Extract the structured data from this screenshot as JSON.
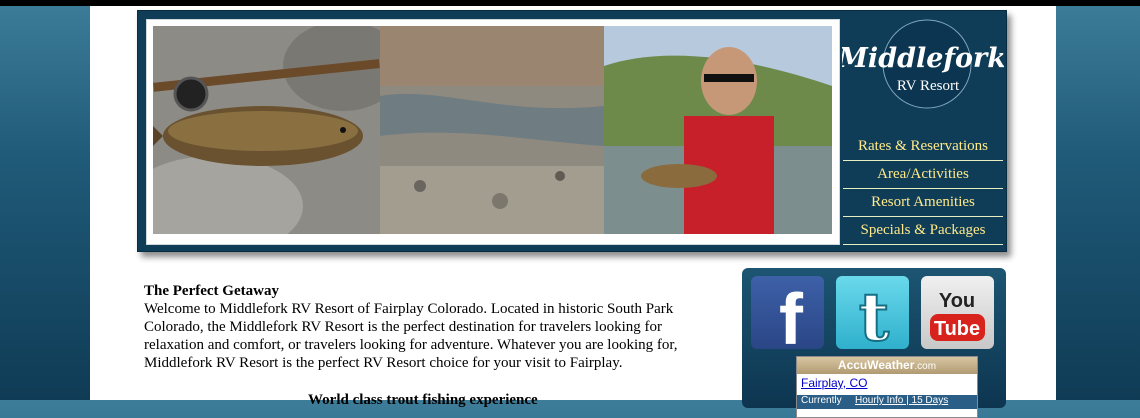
{
  "site": {
    "logo_script": "Middlefork",
    "logo_sub": "RV Resort"
  },
  "nav": {
    "items": [
      {
        "label": "Rates & Reservations"
      },
      {
        "label": "Area/Activities"
      },
      {
        "label": "Resort Amenities"
      },
      {
        "label": "Specials & Packages"
      }
    ]
  },
  "content": {
    "heading": "The Perfect Getaway",
    "body": "Welcome to Middlefork RV Resort of Fairplay Colorado. Located in historic South Park Colorado, the Middlefork RV Resort is the perfect destination for travelers looking for relaxation and comfort, or travelers looking for adventure. Whatever you are looking for, Middlefork RV Resort is the perfect RV Resort choice for your visit to Fairplay.",
    "next_heading": "World class trout fishing experience"
  },
  "social": {
    "facebook_glyph": "f",
    "tumblr_glyph": "t",
    "youtube_top": "You",
    "youtube_bottom": "Tube"
  },
  "weather": {
    "brand": "AccuWeather",
    "brand_suffix": ".com",
    "city": "Fairplay, CO",
    "row_label": "Currently",
    "row_links": "Hourly Info | 15 Days"
  },
  "colors": {
    "background": "#1f5a78",
    "header_bg": "#0f3d57",
    "nav_text": "#ffe98a"
  }
}
